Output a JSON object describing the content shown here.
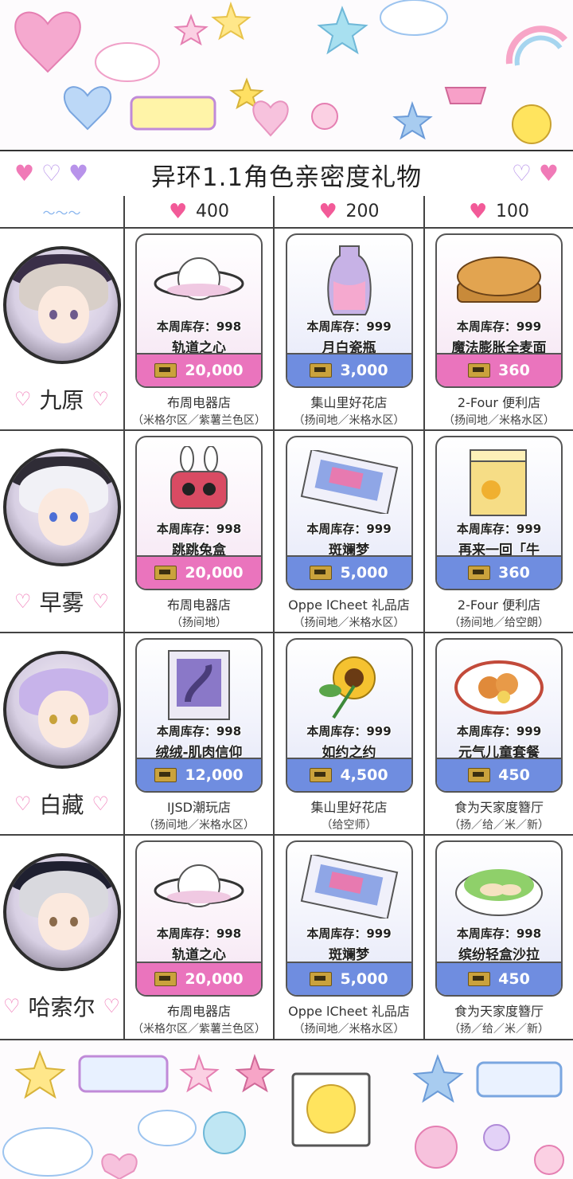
{
  "title": "异环1.1角色亲密度礼物",
  "price_tiers": [
    {
      "value": "400",
      "icon": "heart-icon"
    },
    {
      "value": "200",
      "icon": "heart-icon"
    },
    {
      "value": "100",
      "icon": "heart-icon"
    }
  ],
  "rows": [
    {
      "character": "九原",
      "gifts": [
        {
          "stock": "本周库存：998",
          "name": "轨道之心",
          "price": "20,000",
          "shop": "布周电器店",
          "area": "（米格尔区／紫薯兰色区）",
          "color": "pink",
          "art": "saturn"
        },
        {
          "stock": "本周库存：999",
          "name": "月白瓷瓶",
          "price": "3,000",
          "shop": "集山里好花店",
          "area": "（扬间地／米格水区）",
          "color": "blue",
          "art": "vase"
        },
        {
          "stock": "本周库存：999",
          "name": "魔法膨胀全麦面",
          "price": "360",
          "shop": "2-Four 便利店",
          "area": "（扬间地／米格水区）",
          "color": "pink",
          "art": "bread"
        }
      ]
    },
    {
      "character": "早雾",
      "gifts": [
        {
          "stock": "本周库存：998",
          "name": "跳跳兔盒",
          "price": "20,000",
          "shop": "布周电器店",
          "area": "（扬间地）",
          "color": "pink",
          "art": "robot"
        },
        {
          "stock": "本周库存：999",
          "name": "斑斓梦",
          "price": "5,000",
          "shop": "Oppe lCheet 礼品店",
          "area": "（扬间地／米格水区）",
          "color": "blue",
          "art": "card"
        },
        {
          "stock": "本周库存：999",
          "name": "再来一回「牛",
          "price": "360",
          "shop": "2-Four 便利店",
          "area": "（扬间地／给空朗）",
          "color": "blue",
          "art": "box"
        }
      ]
    },
    {
      "character": "白藏",
      "gifts": [
        {
          "stock": "本周库存：998",
          "name": "绒绒-肌肉信仰",
          "price": "12,000",
          "shop": "IJSD潮玩店",
          "area": "（扬间地／米格水区）",
          "color": "blue",
          "art": "figure"
        },
        {
          "stock": "本周库存：999",
          "name": "如约之约",
          "price": "4,500",
          "shop": "集山里好花店",
          "area": "（给空师）",
          "color": "blue",
          "art": "sunflower"
        },
        {
          "stock": "本周库存：999",
          "name": "元气儿童套餐",
          "price": "450",
          "shop": "食为天家度簪厅",
          "area": "（扬／给／米／新）",
          "color": "blue",
          "art": "plate"
        }
      ]
    },
    {
      "character": "哈索尔",
      "gifts": [
        {
          "stock": "本周库存：998",
          "name": "轨道之心",
          "price": "20,000",
          "shop": "布周电器店",
          "area": "（米格尔区／紫薯兰色区）",
          "color": "pink",
          "art": "saturn"
        },
        {
          "stock": "本周库存：999",
          "name": "斑斓梦",
          "price": "5,000",
          "shop": "Oppe lCheet 礼品店",
          "area": "（扬间地／米格水区）",
          "color": "blue",
          "art": "card"
        },
        {
          "stock": "本周库存：998",
          "name": "缤纷轻盒沙拉",
          "price": "450",
          "shop": "食为天家度簪厅",
          "area": "（扬／给／米／新）",
          "color": "blue",
          "art": "salad"
        }
      ]
    }
  ],
  "colors": {
    "pink_bar": "#ea74bd",
    "blue_bar": "#6f8de0",
    "heart": "#f25a98"
  }
}
